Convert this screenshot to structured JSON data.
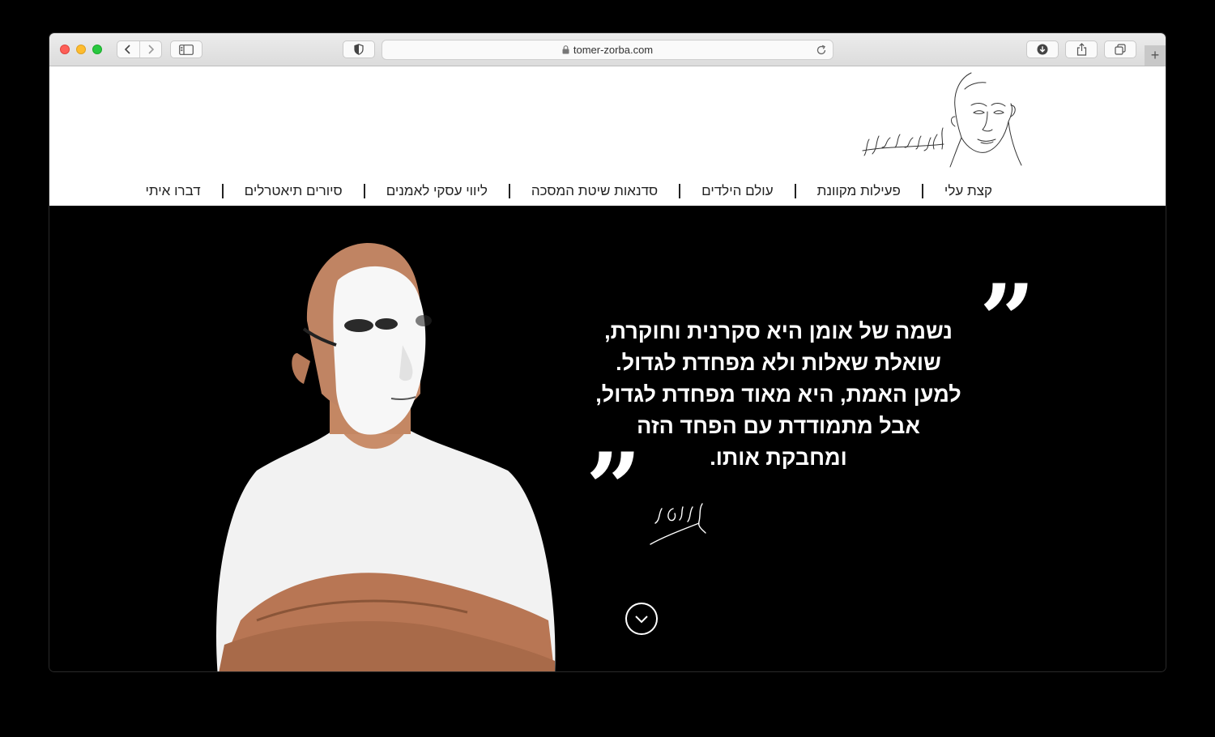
{
  "browser": {
    "url": "tomer-zorba.com",
    "new_tab_label": "+"
  },
  "site": {
    "menu": [
      "קצת עלי",
      "פעילות מקוונת",
      "עולם הילדים",
      "סדנאות שיטת המסכה",
      "ליווי עסקי לאמנים",
      "סיורים תיאטרלים",
      "דברו איתי"
    ],
    "quote_lines": [
      "נשמה של אומן היא סקרנית וחוקרת,",
      "שואלת שאלות ולא מפחדת לגדול.",
      "למען האמת, היא מאוד מפחדת לגדול,",
      "אבל מתמודדת עם הפחד הזה",
      "ומחבקת אותו."
    ],
    "quote_open": "”",
    "quote_close": "”",
    "colors": {
      "page_background": "#000000",
      "header_background": "#ffffff",
      "text_light": "#ffffff",
      "text_dark": "#222222"
    }
  }
}
